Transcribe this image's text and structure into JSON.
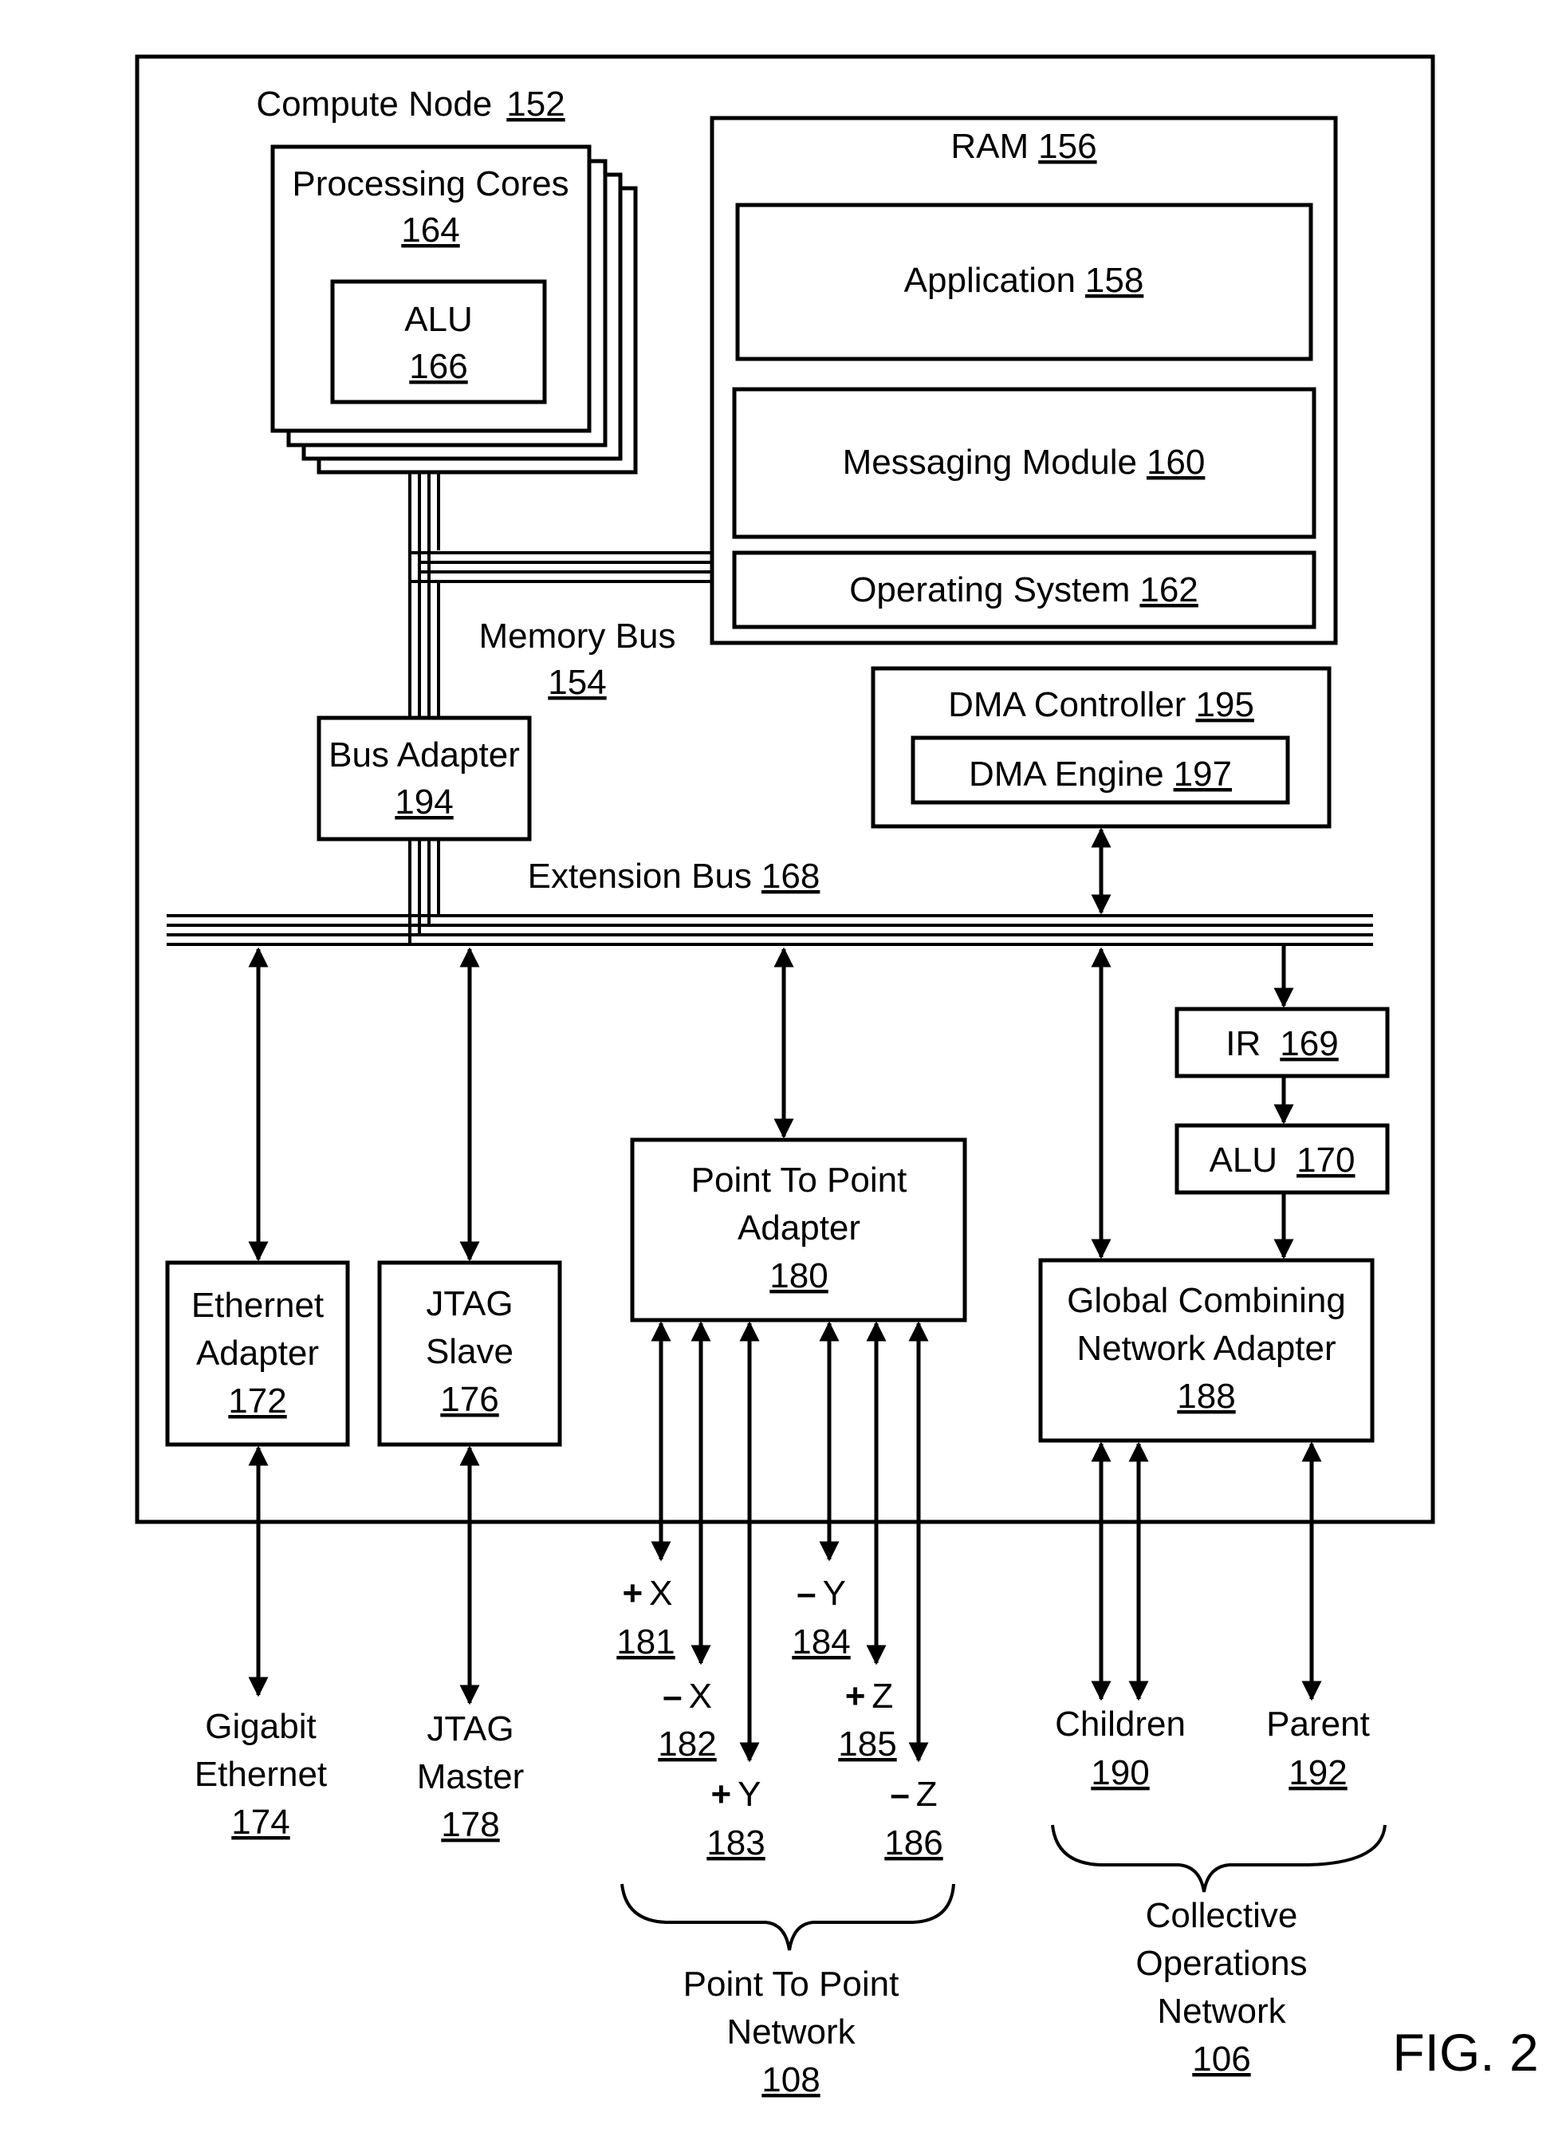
{
  "figure_label": "FIG. 2",
  "compute_node": {
    "label": "Compute Node",
    "ref": "152"
  },
  "processing_cores": {
    "label": "Processing Cores",
    "ref": "164"
  },
  "core_alu": {
    "label": "ALU",
    "ref": "166"
  },
  "ram": {
    "label": "RAM",
    "ref": "156"
  },
  "application": {
    "label": "Application",
    "ref": "158"
  },
  "messaging_module": {
    "label": "Messaging Module",
    "ref": "160"
  },
  "operating_system": {
    "label": "Operating System",
    "ref": "162"
  },
  "memory_bus": {
    "label": "Memory Bus",
    "ref": "154"
  },
  "bus_adapter": {
    "label": "Bus Adapter",
    "ref": "194"
  },
  "dma_controller": {
    "label": "DMA Controller",
    "ref": "195"
  },
  "dma_engine": {
    "label": "DMA Engine",
    "ref": "197"
  },
  "extension_bus": {
    "label": "Extension Bus",
    "ref": "168"
  },
  "ir": {
    "label": "IR",
    "ref": "169"
  },
  "network_alu": {
    "label": "ALU",
    "ref": "170"
  },
  "ethernet_adapter": {
    "lines": [
      "Ethernet",
      "Adapter"
    ],
    "ref": "172"
  },
  "jtag_slave": {
    "lines": [
      "JTAG",
      "Slave"
    ],
    "ref": "176"
  },
  "p2p_adapter": {
    "lines": [
      "Point To Point",
      "Adapter"
    ],
    "ref": "180"
  },
  "gcna": {
    "lines": [
      "Global Combining",
      "Network Adapter"
    ],
    "ref": "188"
  },
  "gigabit_ethernet": {
    "lines": [
      "Gigabit",
      "Ethernet"
    ],
    "ref": "174"
  },
  "jtag_master": {
    "lines": [
      "JTAG",
      "Master"
    ],
    "ref": "178"
  },
  "p2p_links": [
    {
      "sign": "+",
      "axis": "X",
      "ref": "181"
    },
    {
      "sign": "–",
      "axis": "X",
      "ref": "182"
    },
    {
      "sign": "+",
      "axis": "Y",
      "ref": "183"
    },
    {
      "sign": "–",
      "axis": "Y",
      "ref": "184"
    },
    {
      "sign": "+",
      "axis": "Z",
      "ref": "185"
    },
    {
      "sign": "–",
      "axis": "Z",
      "ref": "186"
    }
  ],
  "children": {
    "label": "Children",
    "ref": "190"
  },
  "parent": {
    "label": "Parent",
    "ref": "192"
  },
  "p2p_network": {
    "lines": [
      "Point To Point",
      "Network"
    ],
    "ref": "108"
  },
  "collective_network": {
    "lines": [
      "Collective",
      "Operations",
      "Network"
    ],
    "ref": "106"
  }
}
